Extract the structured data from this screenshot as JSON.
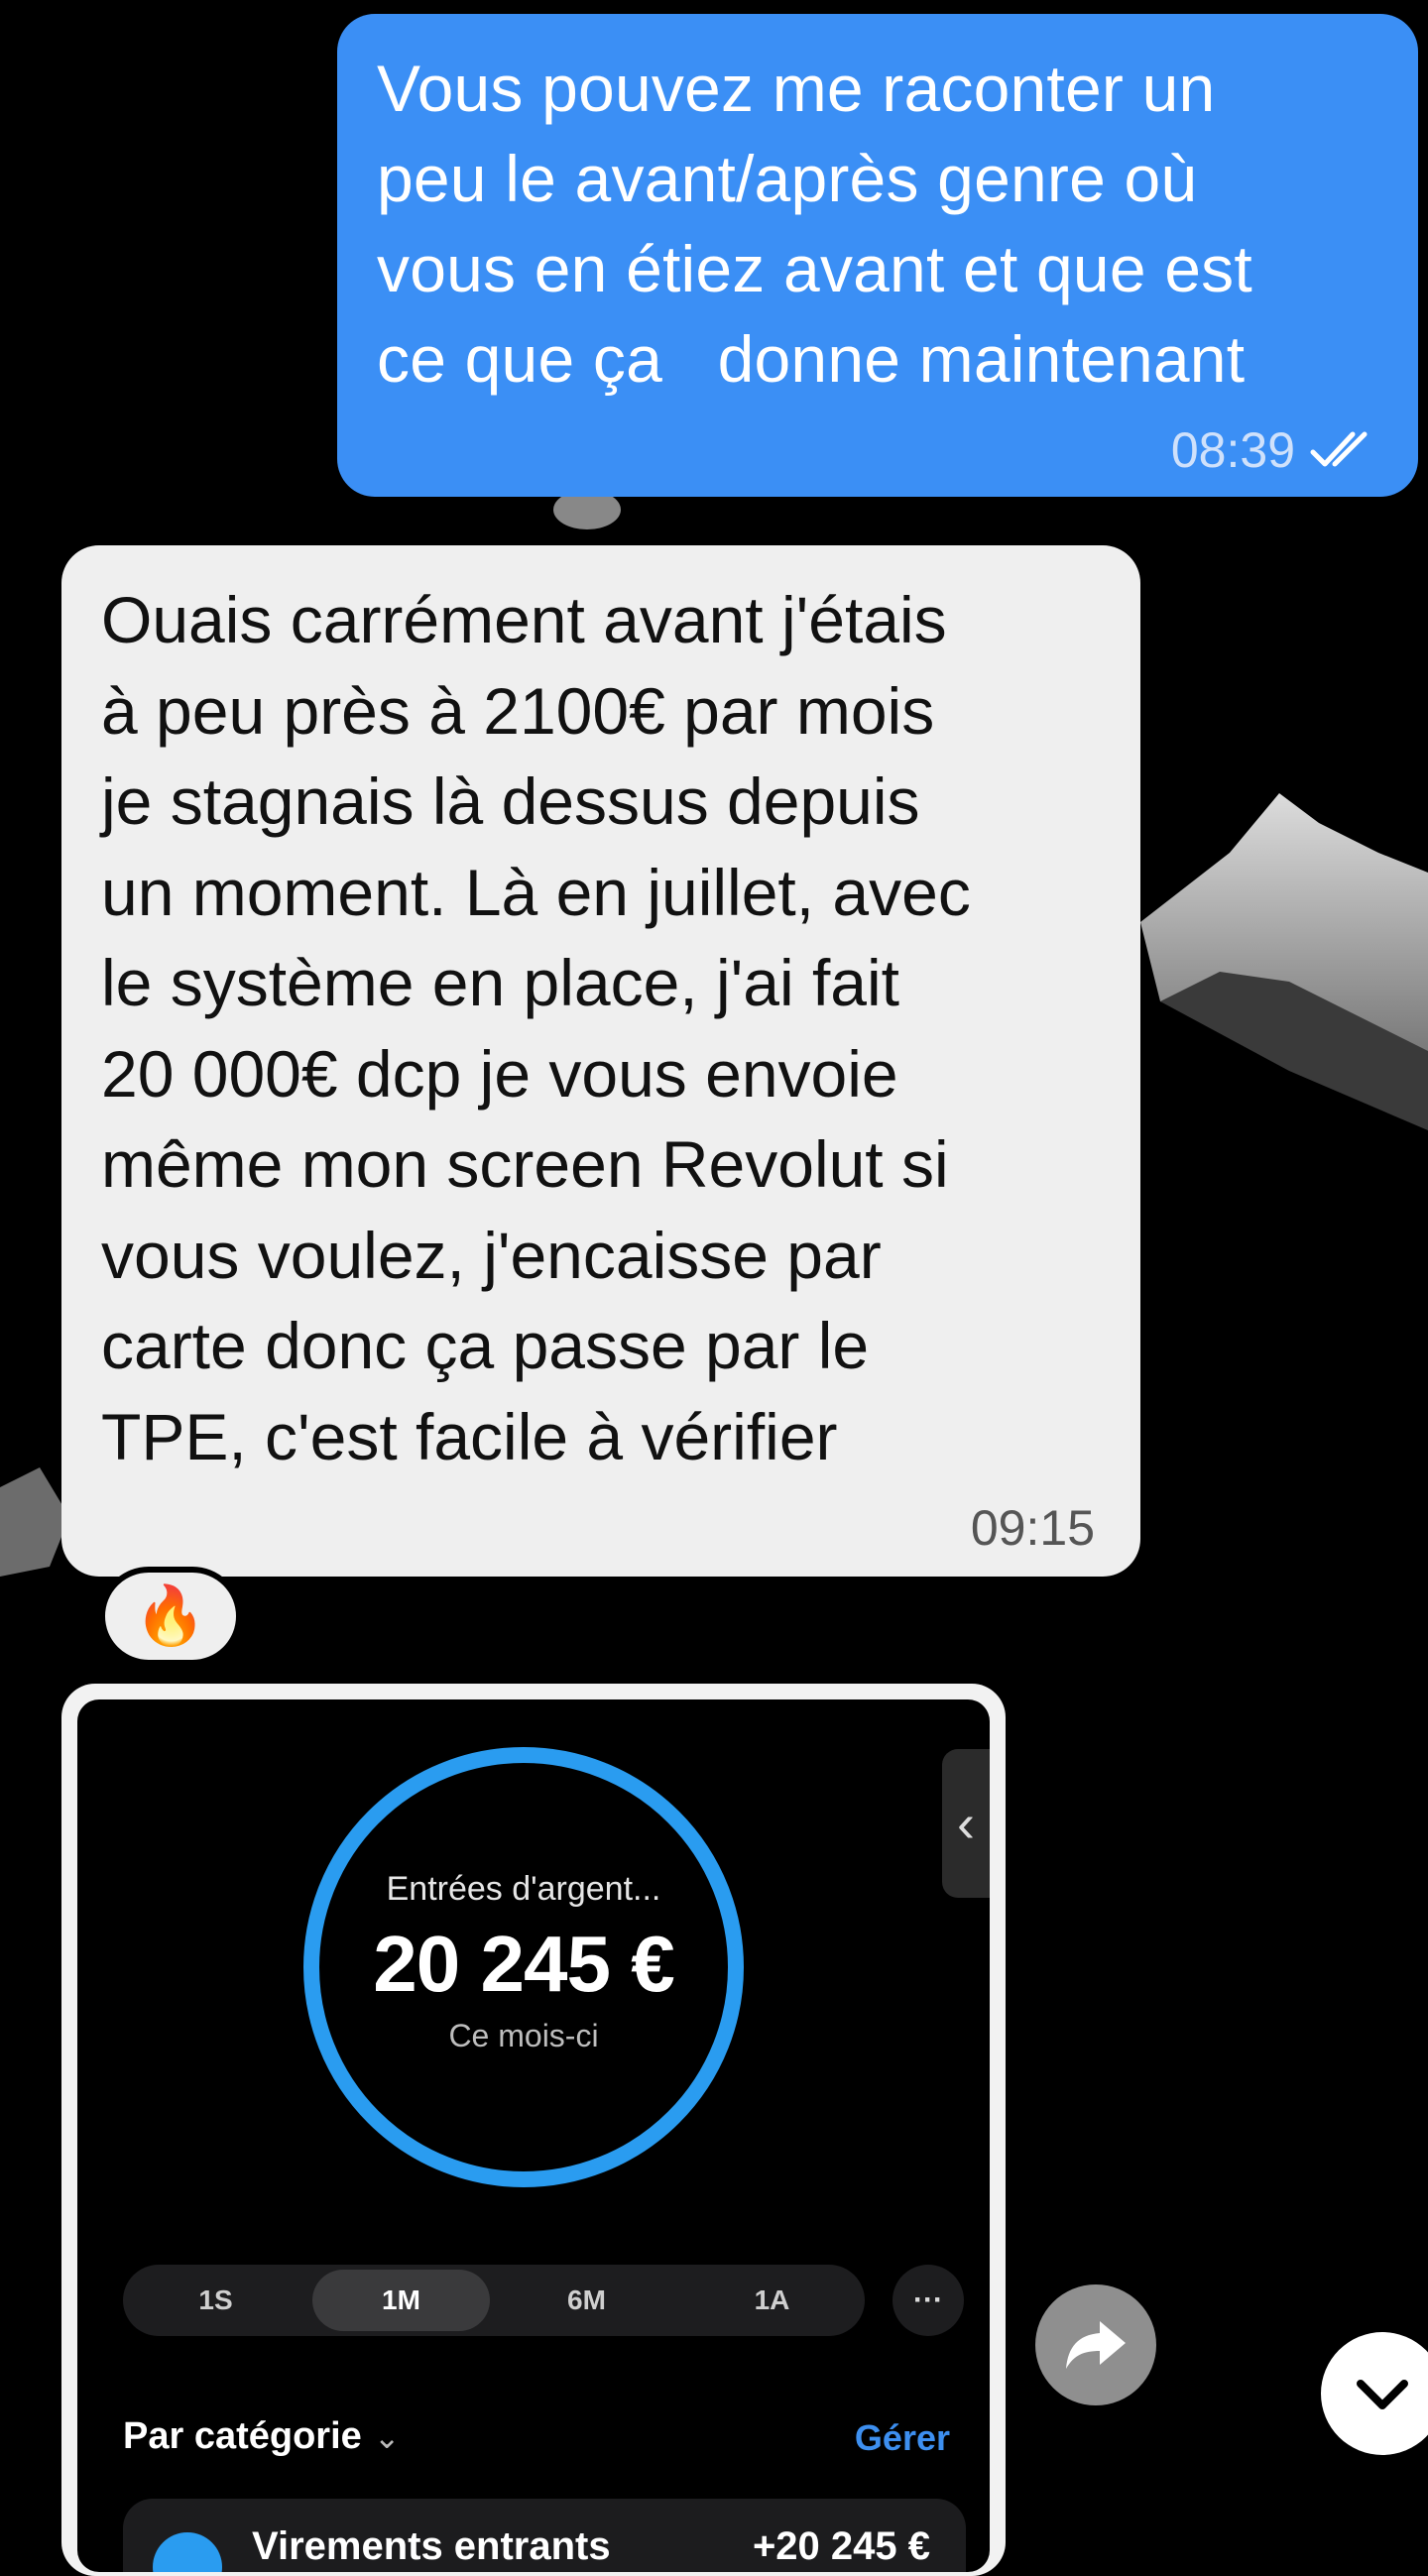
{
  "outgoing_message": {
    "text": "Vous pouvez me raconter un\npeu le avant/après genre où\nvous en étiez avant et que est\nce que ça   donne maintenant",
    "time": "08:39",
    "status_icon": "double-check-icon"
  },
  "incoming_message": {
    "text": "Ouais carrément avant j'étais\nà peu près à 2100€ par mois\nje stagnais là dessus depuis\nun moment. Là en juillet, avec\nle système en place, j'ai fait\n20 000€ dcp je vous envoie\nmême mon screen Revolut si\nvous voulez, j'encaisse par\ncarte donc ça passe par le\nTPE, c'est facile à vérifier",
    "time": "09:15",
    "reaction": "🔥"
  },
  "screenshot_card": {
    "ring_label": "Entrées d'argent...",
    "amount": "20 245 €",
    "period_label": "Ce mois-ci",
    "periods": [
      "1S",
      "1M",
      "6M",
      "1A"
    ],
    "active_period": "1M",
    "more_label": "···",
    "category_title": "Par catégorie",
    "manage_label": "Gérer",
    "row_name": "Virements entrants",
    "row_value": "+20 245 €",
    "accent_color": "#2a9cf0"
  },
  "colors": {
    "outgoing_bubble": "#3b8ff5",
    "incoming_bubble": "#efefef",
    "background": "#000000"
  }
}
